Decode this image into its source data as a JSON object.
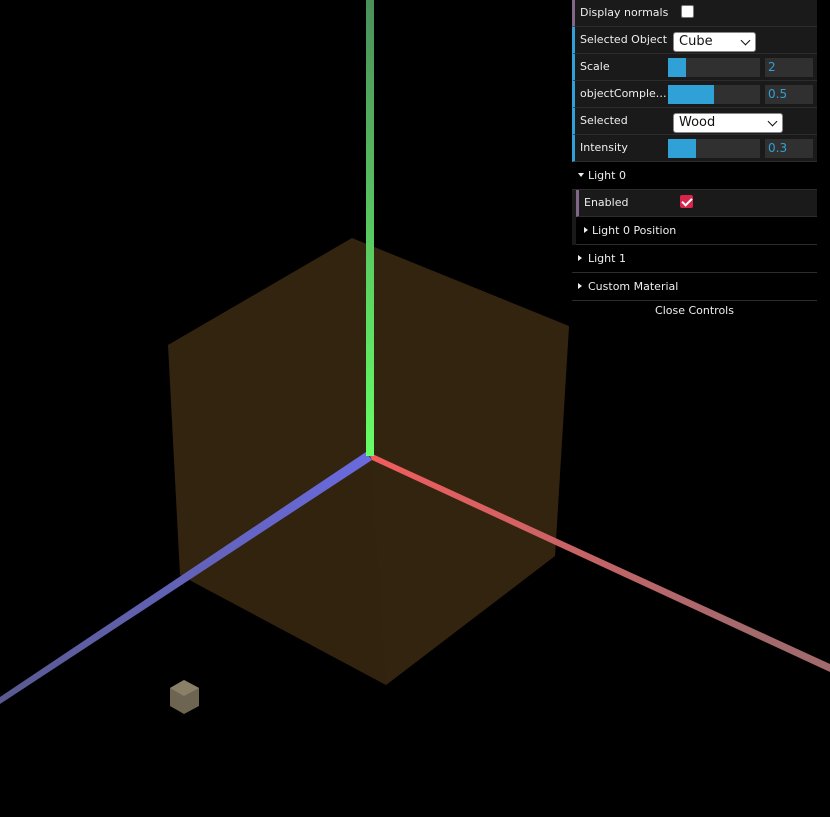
{
  "scene": {
    "axis_colors": {
      "x": "#e85c5c",
      "y": "#66ee66",
      "z": "#6b6bd6"
    },
    "cube_color": "#33240f",
    "small_object_color": "#6e6452"
  },
  "gui": {
    "display_normals": {
      "label": "Display normals",
      "checked": false
    },
    "selected_object": {
      "label": "Selected Object",
      "value": "Cube"
    },
    "scale": {
      "label": "Scale",
      "value": "2",
      "fill": 0.2
    },
    "object_complexity": {
      "label": "objectComplex…",
      "value": "0.5",
      "fill": 0.5
    },
    "selected_material": {
      "label": "Selected",
      "value": "Wood"
    },
    "intensity": {
      "label": "Intensity",
      "value": "0.3",
      "fill": 0.3
    },
    "light0": {
      "title": "Light 0",
      "enabled": {
        "label": "Enabled",
        "checked": true
      },
      "position_folder": "Light 0 Position"
    },
    "light1": {
      "title": "Light 1"
    },
    "custom_material": {
      "title": "Custom Material"
    },
    "close_label": "Close Controls"
  }
}
